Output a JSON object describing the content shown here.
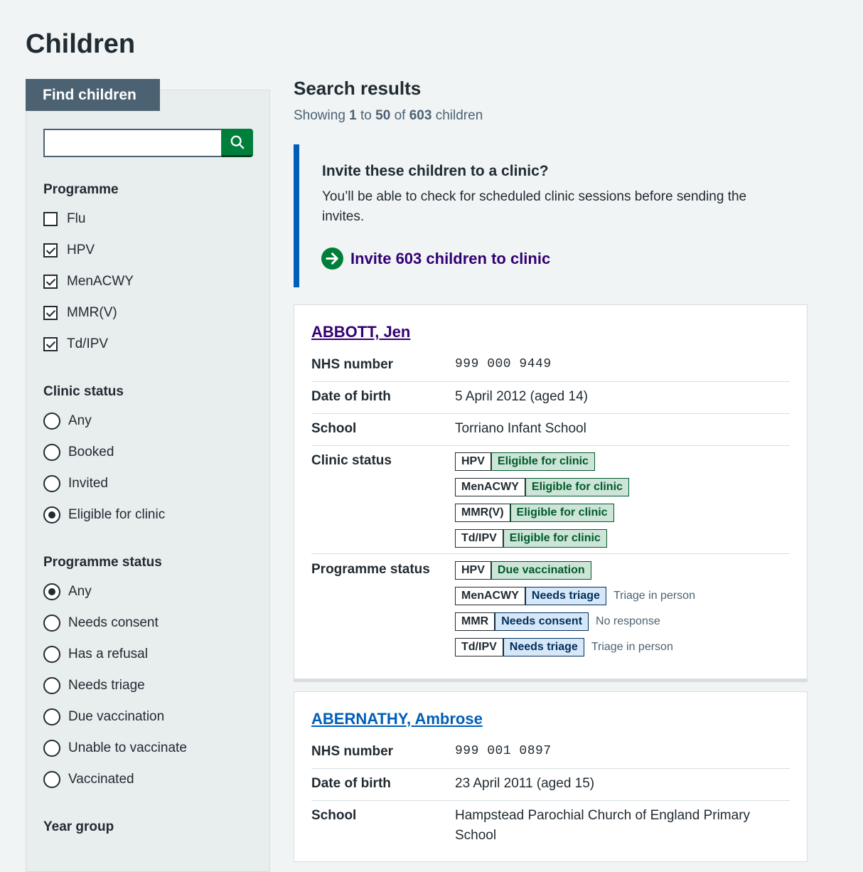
{
  "page_title": "Children",
  "filters": {
    "tab_label": "Find children",
    "search": {
      "value": "",
      "placeholder": ""
    },
    "programme": {
      "legend": "Programme",
      "options": [
        {
          "label": "Flu",
          "checked": false
        },
        {
          "label": "HPV",
          "checked": true
        },
        {
          "label": "MenACWY",
          "checked": true
        },
        {
          "label": "MMR(V)",
          "checked": true
        },
        {
          "label": "Td/IPV",
          "checked": true
        }
      ]
    },
    "clinic_status": {
      "legend": "Clinic status",
      "options": [
        {
          "label": "Any",
          "selected": false
        },
        {
          "label": "Booked",
          "selected": false
        },
        {
          "label": "Invited",
          "selected": false
        },
        {
          "label": "Eligible for clinic",
          "selected": true
        }
      ]
    },
    "programme_status": {
      "legend": "Programme status",
      "options": [
        {
          "label": "Any",
          "selected": true
        },
        {
          "label": "Needs consent",
          "selected": false
        },
        {
          "label": "Has a refusal",
          "selected": false
        },
        {
          "label": "Needs triage",
          "selected": false
        },
        {
          "label": "Due vaccination",
          "selected": false
        },
        {
          "label": "Unable to vaccinate",
          "selected": false
        },
        {
          "label": "Vaccinated",
          "selected": false
        }
      ]
    },
    "year_group": {
      "legend": "Year group"
    }
  },
  "results": {
    "title": "Search results",
    "count": {
      "prefix": "Showing",
      "from": "1",
      "to_word": "to",
      "to": "50",
      "of_word": "of",
      "total": "603",
      "suffix": "children"
    },
    "invite": {
      "title": "Invite these children to a clinic?",
      "text": "You’ll be able to check for scheduled clinic sessions before sending the invites.",
      "link": "Invite 603 children to clinic"
    },
    "children": [
      {
        "name": "ABBOTT, Jen",
        "nhs_label": "NHS number",
        "nhs": "999 000 9449",
        "dob_label": "Date of birth",
        "dob": "5 April 2012 (aged 14)",
        "school_label": "School",
        "school": "Torriano Infant School",
        "clinic_label": "Clinic status",
        "clinic": [
          {
            "programme": "HPV",
            "status": "Eligible for clinic"
          },
          {
            "programme": "MenACWY",
            "status": "Eligible for clinic"
          },
          {
            "programme": "MMR(V)",
            "status": "Eligible for clinic"
          },
          {
            "programme": "Td/IPV",
            "status": "Eligible for clinic"
          }
        ],
        "prog_label": "Programme status",
        "programme_status": [
          {
            "programme": "HPV",
            "status": "Due vaccination",
            "color": "green",
            "note": ""
          },
          {
            "programme": "MenACWY",
            "status": "Needs triage",
            "color": "blue",
            "note": "Triage in person"
          },
          {
            "programme": "MMR",
            "status": "Needs consent",
            "color": "blue",
            "note": "No response"
          },
          {
            "programme": "Td/IPV",
            "status": "Needs triage",
            "color": "blue",
            "note": "Triage in person"
          }
        ]
      },
      {
        "name": "ABERNATHY, Ambrose",
        "nhs_label": "NHS number",
        "nhs": "999 001 0897",
        "dob_label": "Date of birth",
        "dob": "23 April 2011 (aged 15)",
        "school_label": "School",
        "school": "Hampstead Parochial Church of England Primary School"
      }
    ]
  },
  "colors": {
    "link_visited": "#330072",
    "link": "#005eb8",
    "green": "#007f3b",
    "blue_border": "#005eb8"
  }
}
